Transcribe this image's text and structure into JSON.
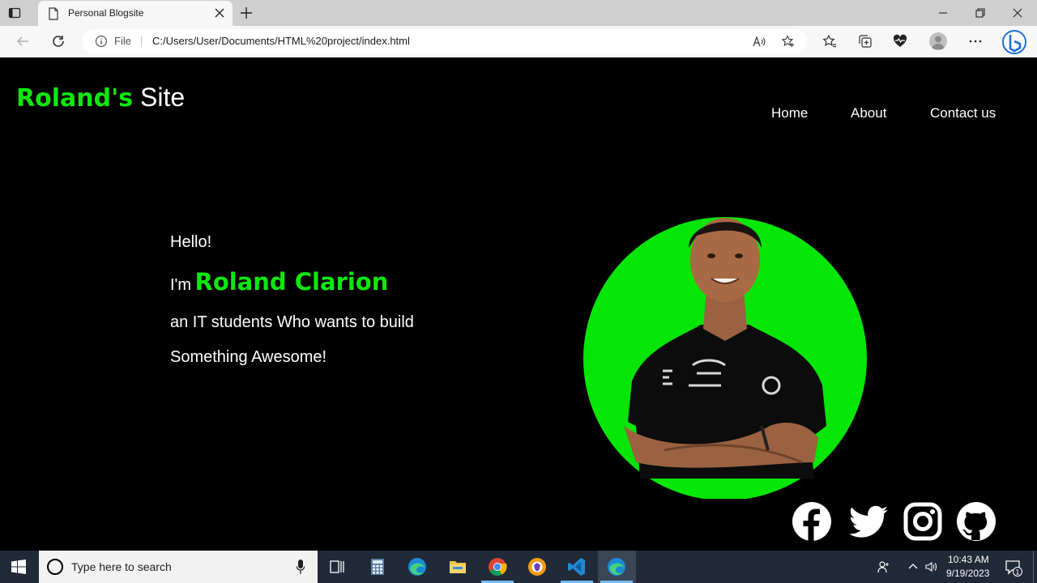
{
  "browser": {
    "tab_title": "Personal Blogsite",
    "file_label": "File",
    "url": "C:/Users/User/Documents/HTML%20project/index.html"
  },
  "site": {
    "logo_strong": "Roland's",
    "logo_rest": "Site",
    "nav": [
      "Home",
      "About",
      "Contact us"
    ],
    "hello": "Hello!",
    "im": "I'm",
    "name": "Roland Clarion",
    "line3": "an IT students Who wants to build",
    "line4": "Something Awesome!",
    "accent_color": "#0ee80e",
    "social_icons": [
      "facebook-icon",
      "twitter-icon",
      "instagram-icon",
      "github-icon"
    ]
  },
  "taskbar": {
    "search_placeholder": "Type here to search",
    "time": "10:43 AM",
    "date": "9/19/2023",
    "notification_count": "1"
  }
}
